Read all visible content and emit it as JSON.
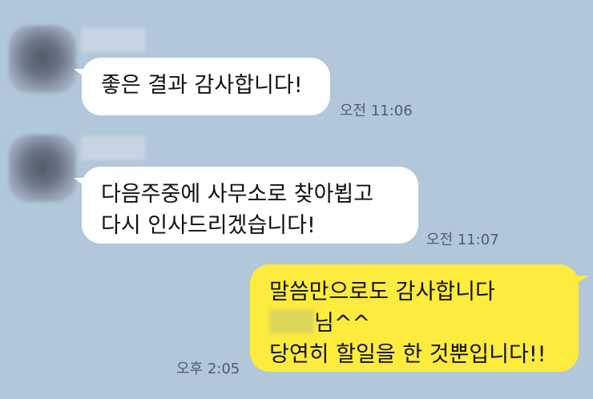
{
  "chat": {
    "messages": [
      {
        "direction": "incoming",
        "lines": [
          "좋은 결과 감사합니다!"
        ],
        "time": "오전 11:06"
      },
      {
        "direction": "incoming",
        "lines": [
          "다음주중에 사무소로 찾아뵙고",
          "다시 인사드리겠습니다!"
        ],
        "time": "오전 11:07"
      },
      {
        "direction": "outgoing",
        "lines": [
          "말씀만으로도 감사합니다",
          "님^^",
          "당연히 할일을 한 것뿐입니다!!"
        ],
        "time": "오후 2:05"
      }
    ]
  },
  "colors": {
    "background": "#b2c7d9",
    "incoming_bubble": "#ffffff",
    "outgoing_bubble": "#fdeb3d",
    "timestamp": "#4f5e6d"
  }
}
